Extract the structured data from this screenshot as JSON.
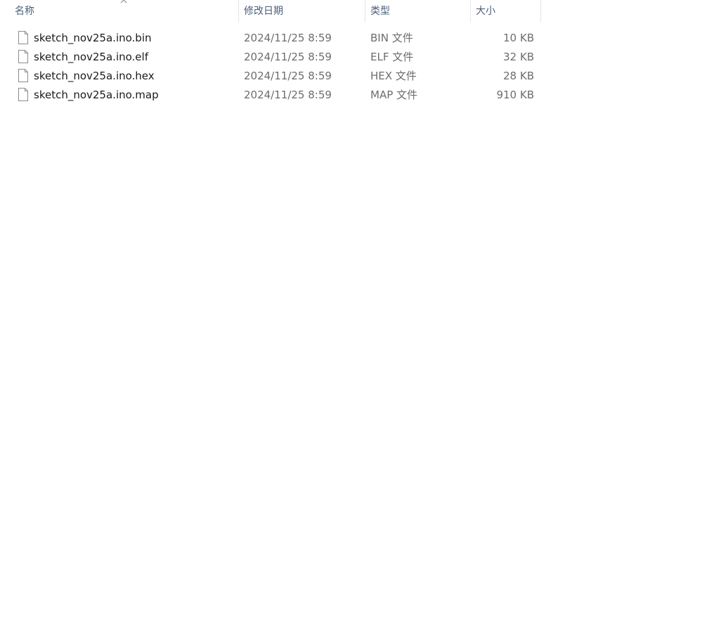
{
  "columns": {
    "name": "名称",
    "date": "修改日期",
    "type": "类型",
    "size": "大小"
  },
  "sort": {
    "column": "name",
    "icon": "chevron-up-icon"
  },
  "files": [
    {
      "name": "sketch_nov25a.ino.bin",
      "date": "2024/11/25 8:59",
      "type": "BIN 文件",
      "size": "10 KB",
      "icon": "file-icon"
    },
    {
      "name": "sketch_nov25a.ino.elf",
      "date": "2024/11/25 8:59",
      "type": "ELF 文件",
      "size": "32 KB",
      "icon": "file-icon"
    },
    {
      "name": "sketch_nov25a.ino.hex",
      "date": "2024/11/25 8:59",
      "type": "HEX 文件",
      "size": "28 KB",
      "icon": "file-icon"
    },
    {
      "name": "sketch_nov25a.ino.map",
      "date": "2024/11/25 8:59",
      "type": "MAP 文件",
      "size": "910 KB",
      "icon": "file-icon"
    }
  ],
  "colors": {
    "header_text": "#4c607a",
    "name_text": "#1a1a1a",
    "detail_text": "#6d6d6d",
    "divider": "#e5e5e5"
  }
}
